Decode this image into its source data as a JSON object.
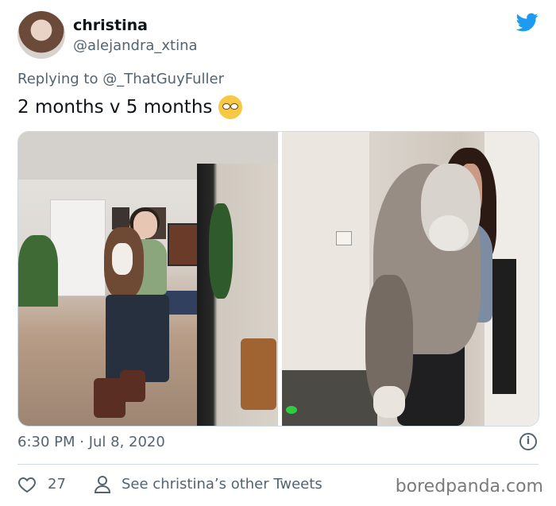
{
  "tweet": {
    "display_name": "christina",
    "handle": "@alejandra_xtina",
    "reply_prefix": "Replying to",
    "reply_to": "@_ThatGuyFuller",
    "text": "2 months v 5 months",
    "emoji": "face-with-rolling-eyes",
    "timestamp": "6:30 PM · Jul 8, 2020",
    "likes": "27",
    "see_other": "See christina’s other Tweets"
  },
  "colors": {
    "twitter_blue": "#1d9bf0",
    "secondary_text": "#536471",
    "primary_text": "#0f1419"
  },
  "watermark": "boredpanda.com"
}
